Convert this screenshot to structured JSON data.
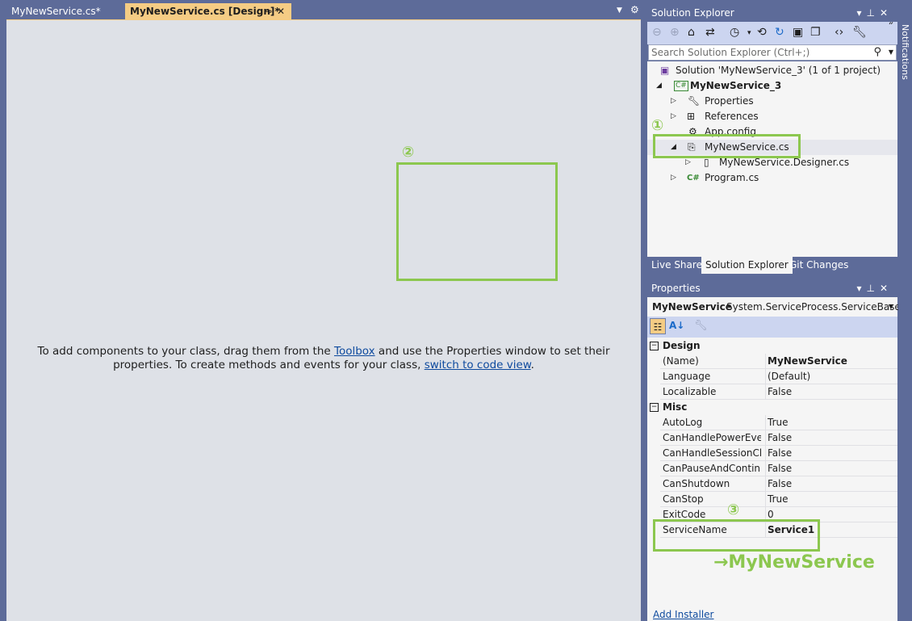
{
  "tabs": {
    "tab1": "MyNewService.cs*",
    "tab2": "MyNewService.cs [Design]*",
    "pin_glyph": "⊸",
    "close_glyph": "✕"
  },
  "designer": {
    "message_part1": "To add components to your class, drag them from the ",
    "toolbox_link": "Toolbox",
    "message_part2": " and use the Properties window to set their properties. To create methods and events for your class, ",
    "code_view_link": "switch to code view",
    "message_part3": "."
  },
  "solution_explorer": {
    "title": "Solution Explorer",
    "search_placeholder": "Search Solution Explorer (Ctrl+;)",
    "tree": {
      "solution": "Solution 'MyNewService_3' (1 of 1 project)",
      "project": "MyNewService_3",
      "properties": "Properties",
      "references": "References",
      "app_config": "App.config",
      "mynewservice": "MyNewService.cs",
      "designer": "MyNewService.Designer.cs",
      "program": "Program.cs"
    },
    "bottom_tabs": [
      "Live Share",
      "Solution Explorer",
      "Git Changes"
    ]
  },
  "properties": {
    "title": "Properties",
    "object_name": "MyNewService",
    "object_type": "System.ServiceProcess.ServiceBase",
    "categories": {
      "design": "Design",
      "misc": "Misc"
    },
    "design_rows": [
      {
        "name": "(Name)",
        "value": "MyNewService"
      },
      {
        "name": "Language",
        "value": "(Default)"
      },
      {
        "name": "Localizable",
        "value": "False"
      }
    ],
    "misc_rows": [
      {
        "name": "AutoLog",
        "value": "True"
      },
      {
        "name": "CanHandlePowerEvent",
        "value": "False"
      },
      {
        "name": "CanHandleSessionChangeEvent",
        "value": "False"
      },
      {
        "name": "CanPauseAndContinue",
        "value": "False"
      },
      {
        "name": "CanShutdown",
        "value": "False"
      },
      {
        "name": "CanStop",
        "value": "True"
      },
      {
        "name": "ExitCode",
        "value": "0"
      },
      {
        "name": "ServiceName",
        "value": "Service1"
      }
    ],
    "add_installer": "Add Installer"
  },
  "annotations": {
    "marker1": "①",
    "marker2": "②",
    "marker3": "③",
    "arrow_text": "→MyNewService"
  },
  "side": {
    "notifications": "Notifications"
  }
}
